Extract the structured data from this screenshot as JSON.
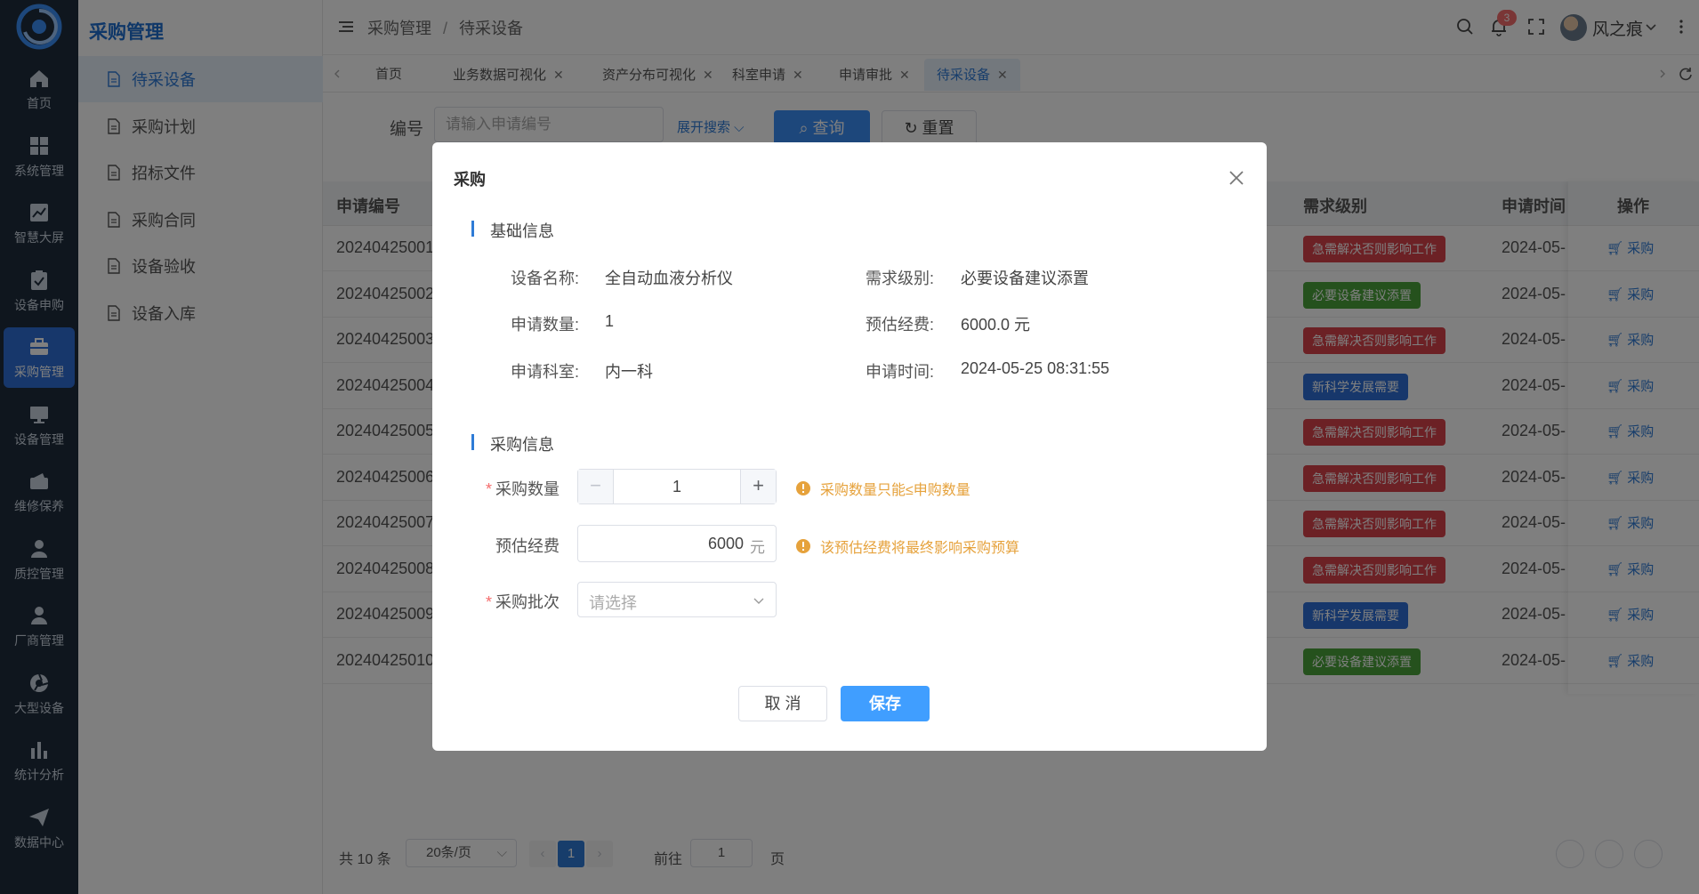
{
  "sidebar_rail": {
    "items": [
      {
        "label": "首页",
        "icon": "home-icon"
      },
      {
        "label": "系统管理",
        "icon": "grid-icon"
      },
      {
        "label": "智慧大屏",
        "icon": "chart-line-icon"
      },
      {
        "label": "设备申购",
        "icon": "clipboard-check-icon"
      },
      {
        "label": "采购管理",
        "icon": "briefcase-icon",
        "active": true
      },
      {
        "label": "设备管理",
        "icon": "monitor-icon"
      },
      {
        "label": "维修保养",
        "icon": "wallet-icon"
      },
      {
        "label": "质控管理",
        "icon": "user-tie-icon"
      },
      {
        "label": "厂商管理",
        "icon": "user-icon"
      },
      {
        "label": "大型设备",
        "icon": "aperture-icon"
      },
      {
        "label": "统计分析",
        "icon": "bar-chart-icon"
      },
      {
        "label": "数据中心",
        "icon": "paper-plane-icon"
      }
    ]
  },
  "sidebar": {
    "title": "采购管理",
    "items": [
      {
        "label": "待采设备",
        "active": true
      },
      {
        "label": "采购计划"
      },
      {
        "label": "招标文件"
      },
      {
        "label": "采购合同"
      },
      {
        "label": "设备验收"
      },
      {
        "label": "设备入库"
      }
    ]
  },
  "header": {
    "breadcrumb": [
      "采购管理",
      "待采设备"
    ],
    "notification_count": "3",
    "user_name": "风之痕"
  },
  "tabs": [
    {
      "label": "首页",
      "closable": false
    },
    {
      "label": "业务数据可视化",
      "closable": true
    },
    {
      "label": "资产分布可视化",
      "closable": true
    },
    {
      "label": "科室申请",
      "closable": true
    },
    {
      "label": "申请审批",
      "closable": true
    },
    {
      "label": "待采设备",
      "closable": true,
      "active": true
    }
  ],
  "filter": {
    "label": "编号",
    "placeholder": "请输入申请编号",
    "expand_label": "展开搜索",
    "query_label": "查询",
    "reset_label": "重置"
  },
  "table": {
    "columns": [
      "申请编号",
      "需求级别",
      "申请时间",
      "操作"
    ],
    "op_label": "采购",
    "rows": [
      {
        "id": "20240425001",
        "level": "急需解决否则影响工作",
        "level_color": "#d9434b",
        "time": "2024-05-"
      },
      {
        "id": "20240425002",
        "level": "必要设备建议添置",
        "level_color": "#4aa33b",
        "time": "2024-05-"
      },
      {
        "id": "20240425003",
        "level": "急需解决否则影响工作",
        "level_color": "#d9434b",
        "time": "2024-05-"
      },
      {
        "id": "20240425004",
        "level": "新科学发展需要",
        "level_color": "#2e6fd6",
        "time": "2024-05-"
      },
      {
        "id": "20240425005",
        "level": "急需解决否则影响工作",
        "level_color": "#d9434b",
        "time": "2024-05-"
      },
      {
        "id": "20240425006",
        "level": "急需解决否则影响工作",
        "level_color": "#d9434b",
        "time": "2024-05-"
      },
      {
        "id": "20240425007",
        "level": "急需解决否则影响工作",
        "level_color": "#d9434b",
        "time": "2024-05-"
      },
      {
        "id": "20240425008",
        "level": "急需解决否则影响工作",
        "level_color": "#d9434b",
        "time": "2024-05-"
      },
      {
        "id": "20240425009",
        "level": "新科学发展需要",
        "level_color": "#2e6fd6",
        "time": "2024-05-"
      },
      {
        "id": "20240425010",
        "level": "必要设备建议添置",
        "level_color": "#4aa33b",
        "time": "2024-05-"
      }
    ]
  },
  "pagination": {
    "total": "共 10 条",
    "page_size": "20条/页",
    "current_page": "1",
    "goto_label": "前往",
    "goto_value": "1",
    "page_suffix": "页"
  },
  "dialog": {
    "title": "采购",
    "basic_section": "基础信息",
    "basic_info": {
      "device_name_label": "设备名称:",
      "device_name": "全自动血液分析仪",
      "level_label": "需求级别:",
      "level": "必要设备建议添置",
      "qty_label": "申请数量:",
      "qty": "1",
      "budget_label": "预估经费:",
      "budget": "6000.0 元",
      "dept_label": "申请科室:",
      "dept": "内一科",
      "time_label": "申请时间:",
      "time": "2024-05-25 08:31:55"
    },
    "purchase_section": "采购信息",
    "purchase_qty_label": "采购数量",
    "purchase_qty": "1",
    "purchase_qty_hint": "采购数量只能≤申购数量",
    "estimate_label": "预估经费",
    "estimate_value": "6000",
    "estimate_unit": "元",
    "estimate_hint": "该预估经费将最终影响采购预算",
    "batch_label": "采购批次",
    "batch_placeholder": "请选择",
    "cancel_label": "取 消",
    "save_label": "保存"
  },
  "colors": {
    "primary": "#2e7bd6",
    "rail_bg": "#1f2d3d",
    "warning": "#e6a23c",
    "danger": "#f56c6c"
  }
}
